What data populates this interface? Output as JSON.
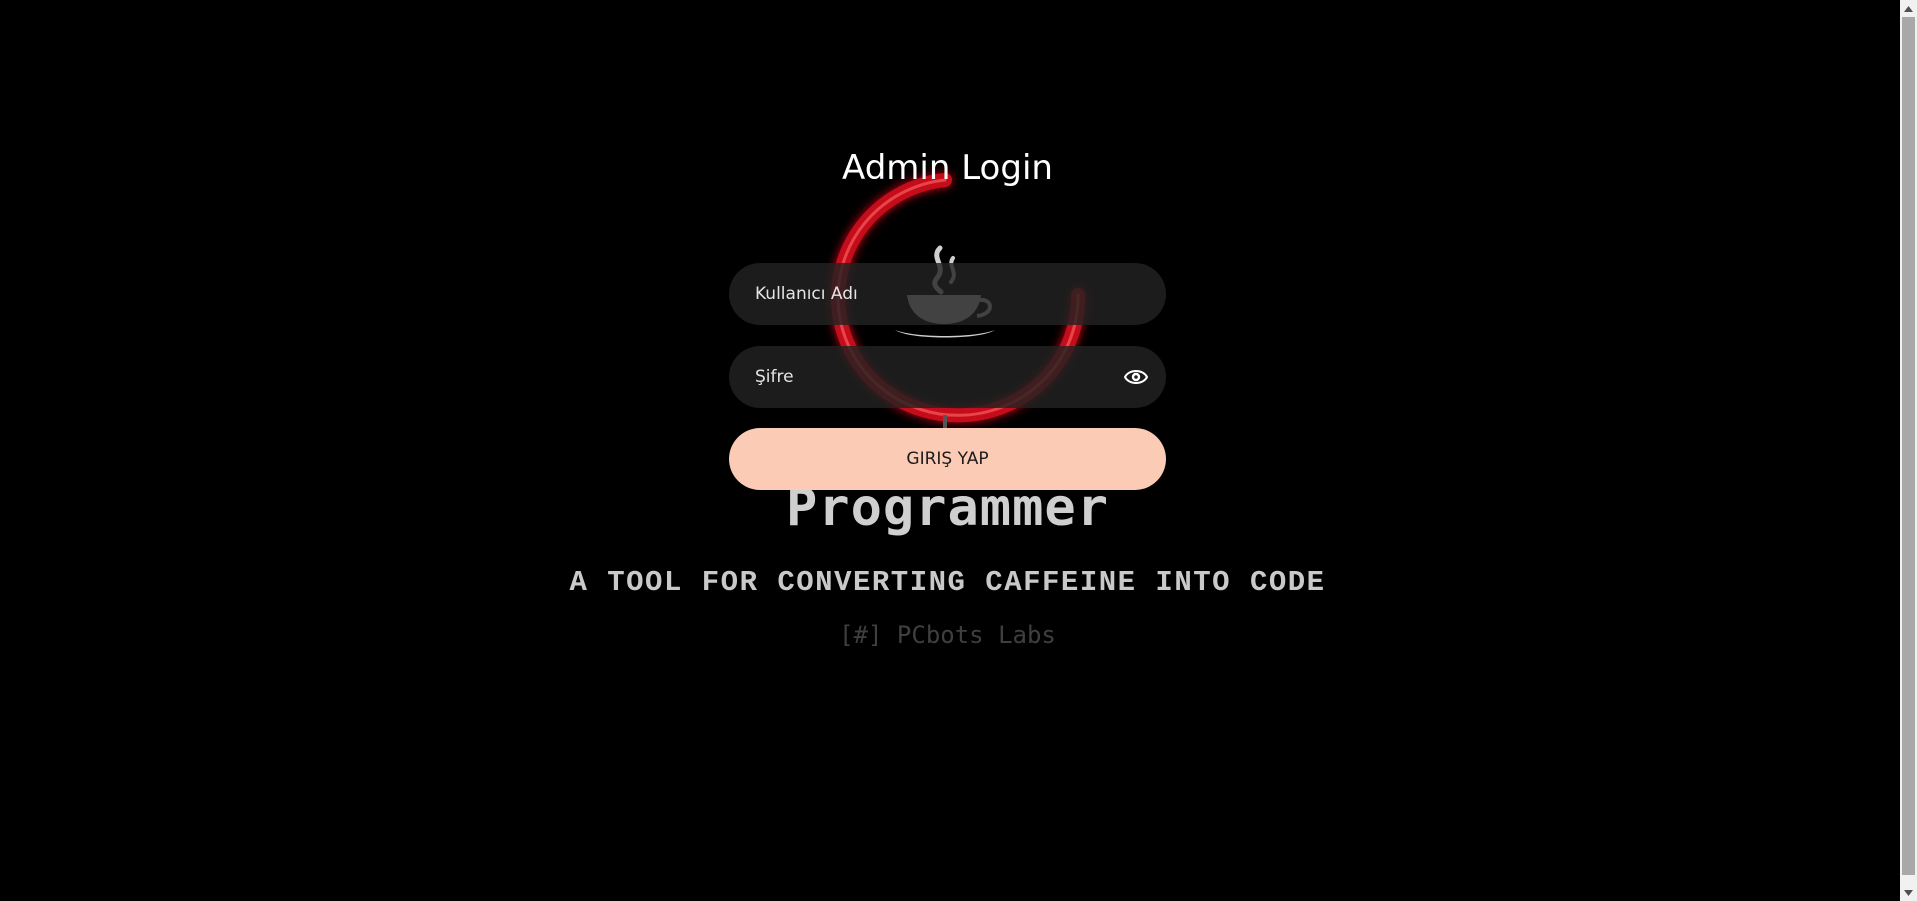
{
  "login": {
    "title": "Admin Login",
    "username_placeholder": "Kullanıcı Adı",
    "password_placeholder": "Şifre",
    "submit_label": "GIRIŞ YAP",
    "eye_icon": "eye-icon"
  },
  "background": {
    "brand_title": "Programmer",
    "tagline": "A TOOL FOR CONVERTING CAFFEINE INTO CODE",
    "lab_name": "[#] PCbots Labs",
    "ring_icon": "power-ring-icon",
    "cup_icon": "coffee-cup-icon"
  },
  "colors": {
    "background": "#000000",
    "input_bg": "#222222",
    "button_bg": "#fbcbb5",
    "ring": "#d0101a"
  }
}
